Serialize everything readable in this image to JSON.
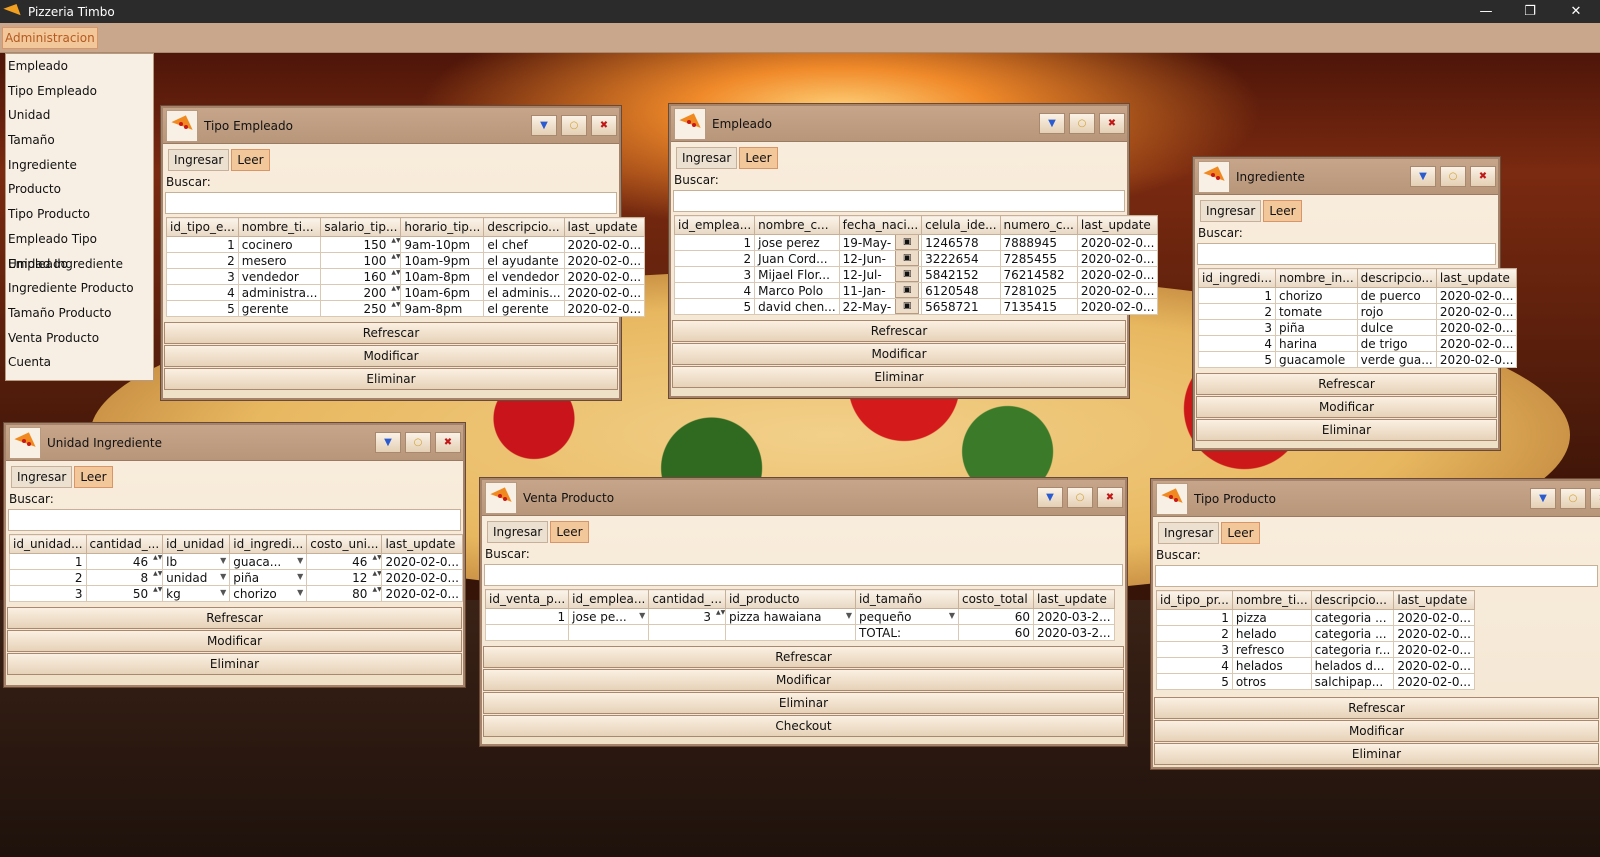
{
  "app": {
    "title": "Pizzeria Timbo"
  },
  "window_controls": {
    "minimize": "—",
    "restore": "❐",
    "close": "✕"
  },
  "menubar": {
    "admin": "Administracion"
  },
  "menu_items": [
    "Empleado",
    "Tipo Empleado",
    "Unidad",
    "Tamaño",
    "Ingrediente",
    "Producto",
    "Tipo Producto",
    "Empleado Tipo Empleado",
    "Unidad Ingrediente",
    "Ingrediente Producto",
    "Tamaño Producto",
    "Venta Producto",
    "Cuenta"
  ],
  "common": {
    "tab_ingresar": "Ingresar",
    "tab_leer": "Leer",
    "buscar": "Buscar:",
    "refrescar": "Refrescar",
    "modificar": "Modificar",
    "eliminar": "Eliminar",
    "checkout": "Checkout",
    "btn_min": "▼",
    "btn_max": "○",
    "btn_close": "✖"
  },
  "tipo_empleado": {
    "title": "Tipo Empleado",
    "columns": [
      "id_tipo_e...",
      "nombre_ti...",
      "salario_tip...",
      "horario_tip...",
      "descripcio...",
      "last_update"
    ],
    "rows": [
      [
        "1",
        "cocinero",
        "150",
        "9am-10pm",
        "el chef",
        "2020-02-0..."
      ],
      [
        "2",
        "mesero",
        "100",
        "10am-9pm",
        "el ayudante",
        "2020-02-0..."
      ],
      [
        "3",
        "vendedor",
        "160",
        "10am-8pm",
        "el vendedor",
        "2020-02-0..."
      ],
      [
        "4",
        "administra...",
        "200",
        "10am-6pm",
        "el adminis...",
        "2020-02-0..."
      ],
      [
        "5",
        "gerente",
        "250",
        "9am-8pm",
        "el gerente",
        "2020-02-0..."
      ]
    ]
  },
  "empleado": {
    "title": "Empleado",
    "columns": [
      "id_emplea...",
      "nombre_c...",
      "fecha_naci...",
      "celula_ide...",
      "numero_c...",
      "last_update"
    ],
    "rows": [
      [
        "1",
        "jose perez",
        "19-May-",
        "1246578",
        "7888945",
        "2020-02-0..."
      ],
      [
        "2",
        "Juan Cord...",
        "12-Jun-",
        "3222654",
        "7285455",
        "2020-02-0..."
      ],
      [
        "3",
        "Mijael Flor...",
        "12-Jul-",
        "5842152",
        "76214582",
        "2020-02-0..."
      ],
      [
        "4",
        "Marco Polo",
        "11-Jan-",
        "6120548",
        "7281025",
        "2020-02-0..."
      ],
      [
        "5",
        "david chen...",
        "22-May-",
        "5658721",
        "7135415",
        "2020-02-0..."
      ]
    ]
  },
  "ingrediente": {
    "title": "Ingrediente",
    "columns": [
      "id_ingredi...",
      "nombre_in...",
      "descripcio...",
      "last_update"
    ],
    "rows": [
      [
        "1",
        "chorizo",
        "de puerco",
        "2020-02-0..."
      ],
      [
        "2",
        "tomate",
        "rojo",
        "2020-02-0..."
      ],
      [
        "3",
        "piña",
        "dulce",
        "2020-02-0..."
      ],
      [
        "4",
        "harina",
        "de trigo",
        "2020-02-0..."
      ],
      [
        "5",
        "guacamole",
        "verde gua...",
        "2020-02-0..."
      ]
    ]
  },
  "unidad_ingrediente": {
    "title": "Unidad Ingrediente",
    "columns": [
      "id_unidad...",
      "cantidad_...",
      "id_unidad",
      "id_ingredi...",
      "costo_uni...",
      "last_update"
    ],
    "rows": [
      [
        "1",
        "46",
        "lb",
        "guaca...",
        "46",
        "2020-02-0..."
      ],
      [
        "2",
        "8",
        "unidad",
        "piña",
        "12",
        "2020-02-0..."
      ],
      [
        "3",
        "50",
        "kg",
        "chorizo",
        "80",
        "2020-02-0..."
      ]
    ]
  },
  "venta_producto": {
    "title": "Venta Producto",
    "columns": [
      "id_venta_p...",
      "id_emplea...",
      "cantidad_...",
      "id_producto",
      "id_tamaño",
      "costo_total",
      "last_update"
    ],
    "rows": [
      [
        "1",
        "jose pe...",
        "3",
        "pizza hawaiana",
        "pequeño",
        "60",
        "2020-03-2..."
      ]
    ],
    "total_label": "TOTAL:",
    "total_value": "60",
    "total_date": "2020-03-2..."
  },
  "tipo_producto": {
    "title": "Tipo Producto",
    "columns": [
      "id_tipo_pr...",
      "nombre_ti...",
      "descripcio...",
      "last_update"
    ],
    "rows": [
      [
        "1",
        "pizza",
        "categoria ...",
        "2020-02-0..."
      ],
      [
        "2",
        "helado",
        "categoria ...",
        "2020-02-0..."
      ],
      [
        "3",
        "refresco",
        "categoria r...",
        "2020-02-0..."
      ],
      [
        "4",
        "helados",
        "helados d...",
        "2020-02-0..."
      ],
      [
        "5",
        "otros",
        "salchipap...",
        "2020-02-0..."
      ]
    ]
  }
}
